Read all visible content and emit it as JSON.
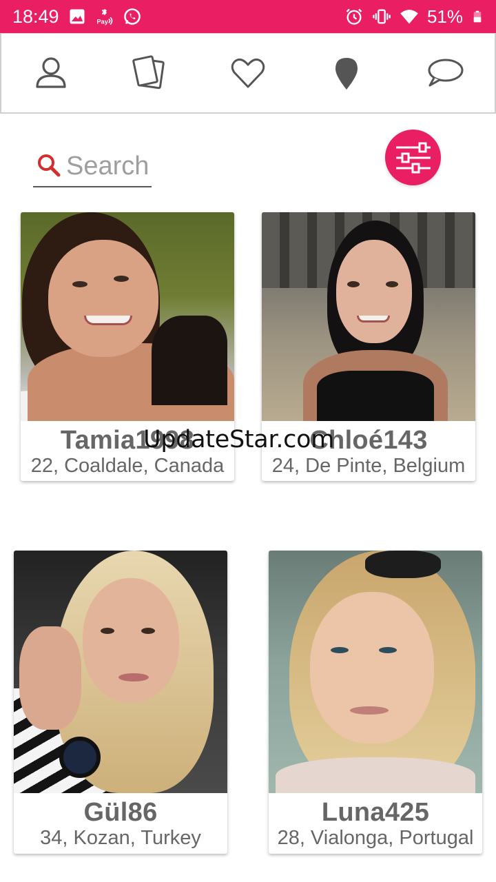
{
  "status_bar": {
    "time": "18:49",
    "battery_percent": "51%",
    "left_icons": [
      "image-icon",
      "caixa-pay-icon",
      "whatsapp-icon"
    ],
    "right_icons": [
      "alarm-icon",
      "vibrate-icon",
      "wifi-icon",
      "battery-icon"
    ],
    "color": "#e91e63"
  },
  "nav": {
    "items": [
      "profile-icon",
      "cards-icon",
      "heart-icon",
      "location-pin-icon",
      "chat-bubble-icon"
    ]
  },
  "search": {
    "placeholder": "Search"
  },
  "filter": {
    "icon": "sliders-icon"
  },
  "profiles": [
    {
      "name": "Tamia1998",
      "details": "22, Coaldale, Canada"
    },
    {
      "name": "Chloé143",
      "details": "24, De Pinte, Belgium"
    },
    {
      "name": "Gül86",
      "details": "34, Kozan, Turkey"
    },
    {
      "name": "Luna425",
      "details": "28, Vialonga, Portugal"
    }
  ],
  "watermark": "UpdateStar.com",
  "accent_color": "#e91e63"
}
